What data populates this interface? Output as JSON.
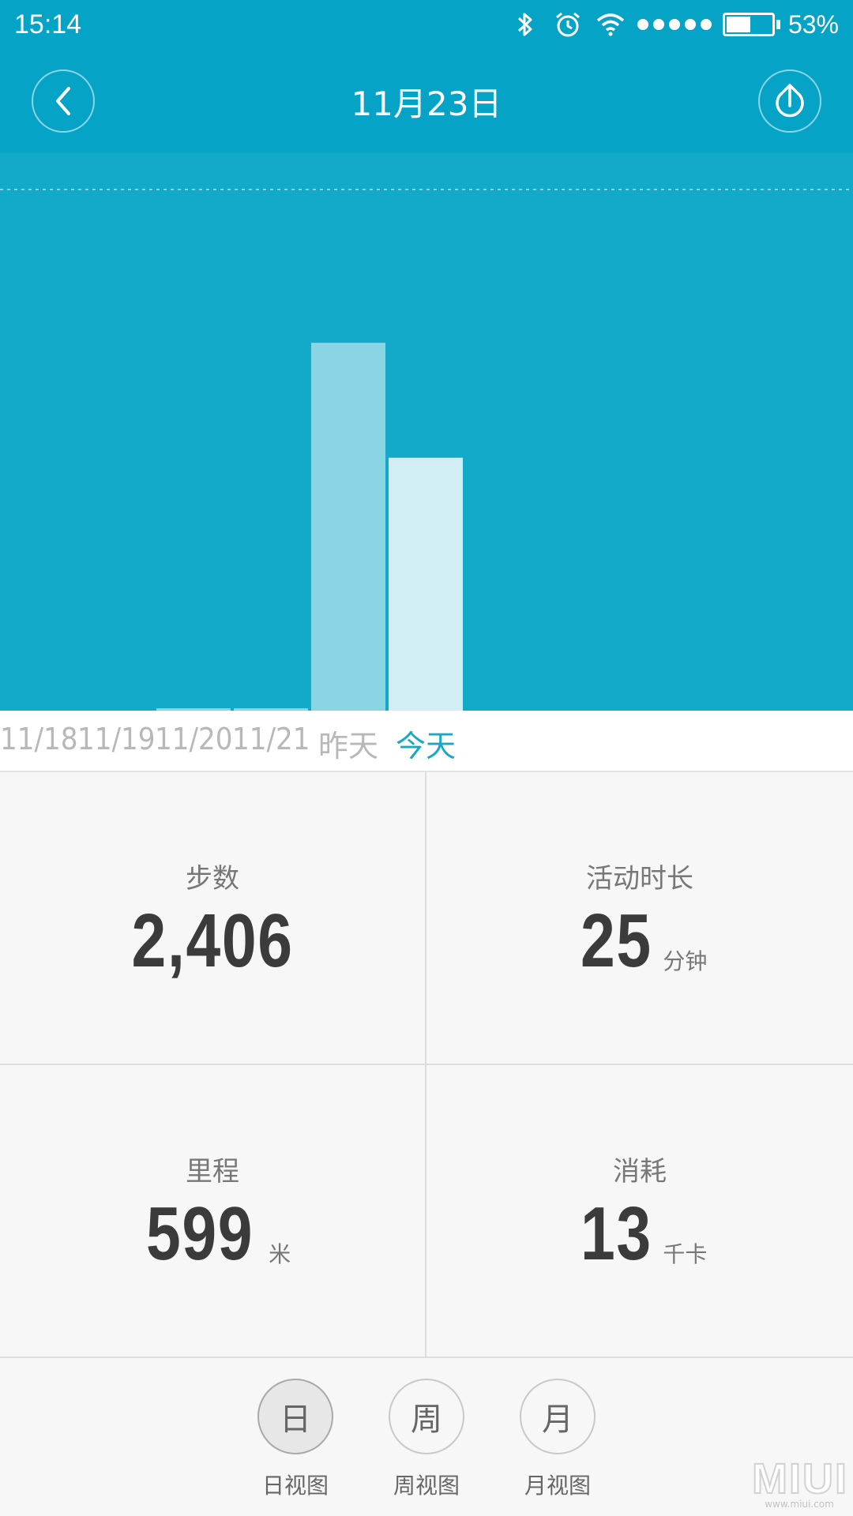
{
  "status_bar": {
    "time": "15:14",
    "battery_percent_text": "53%",
    "battery_level": 0.53,
    "icons": [
      "bluetooth-icon",
      "alarm-icon",
      "wifi-icon",
      "signal-dots-icon",
      "battery-icon"
    ]
  },
  "header": {
    "title": "11月23日",
    "back_icon": "chevron-left-icon",
    "share_icon": "upload-icon"
  },
  "chart_data": {
    "type": "bar",
    "categories": [
      "11/18",
      "11/19",
      "11/20",
      "11/21",
      "昨天",
      "今天"
    ],
    "values": [
      0,
      0,
      30,
      30,
      4800,
      3300
    ],
    "selected_index": 5,
    "ylim": [
      0,
      6800
    ],
    "grid": "dotted top line",
    "colors": {
      "background": "#13a9c8",
      "bar": "#8ad5e4",
      "bar_selected": "#d0eef4",
      "dotted_line": "#7fd3e3"
    }
  },
  "stats": {
    "steps": {
      "label": "步数",
      "value": "2,406",
      "unit": ""
    },
    "active_time": {
      "label": "活动时长",
      "value": "25",
      "unit": "分钟"
    },
    "distance": {
      "label": "里程",
      "value": "599",
      "unit": "米"
    },
    "calories": {
      "label": "消耗",
      "value": "13",
      "unit": "千卡"
    }
  },
  "view_switch": {
    "day": {
      "glyph": "日",
      "caption": "日视图",
      "selected": true
    },
    "week": {
      "glyph": "周",
      "caption": "周视图",
      "selected": false
    },
    "month": {
      "glyph": "月",
      "caption": "月视图",
      "selected": false
    }
  },
  "watermark": {
    "text": "MIUI",
    "sub": "www.miui.com"
  },
  "colors": {
    "header_bg": "#05a4c6",
    "accent": "#17a8c5",
    "text_dark": "#3b3b3b",
    "text_muted": "#777777"
  }
}
